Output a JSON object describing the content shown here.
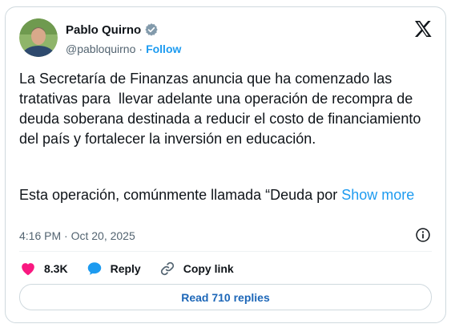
{
  "author": {
    "name": "Pablo Quirno",
    "handle": "@pabloquirno",
    "separator": "·",
    "follow_label": "Follow"
  },
  "tweet": {
    "paragraph1": "La Secretaría de Finanzas anuncia que ha comenzado las tratativas para  llevar adelante una operación de recompra de deuda soberana destinada a reducir el costo de financiamiento del país y fortalecer la inversión en educación.",
    "paragraph2": "Esta operación, comúnmente llamada “Deuda por ",
    "show_more_label": "Show more",
    "timestamp": "4:16 PM · Oct 20, 2025"
  },
  "actions": {
    "likes_count": "8.3K",
    "reply_label": "Reply",
    "copy_link_label": "Copy link"
  },
  "read_replies_label": "Read 710 replies",
  "colors": {
    "accent": "#1d9bf0",
    "like": "#f91880",
    "text": "#0f1419",
    "muted": "#536471",
    "border": "#cfd9de"
  },
  "icons": {
    "verified": "verified-badge-icon",
    "platform": "x-logo-icon",
    "info": "info-icon",
    "like": "heart-icon",
    "reply": "speech-bubble-icon",
    "copy_link": "link-icon"
  }
}
